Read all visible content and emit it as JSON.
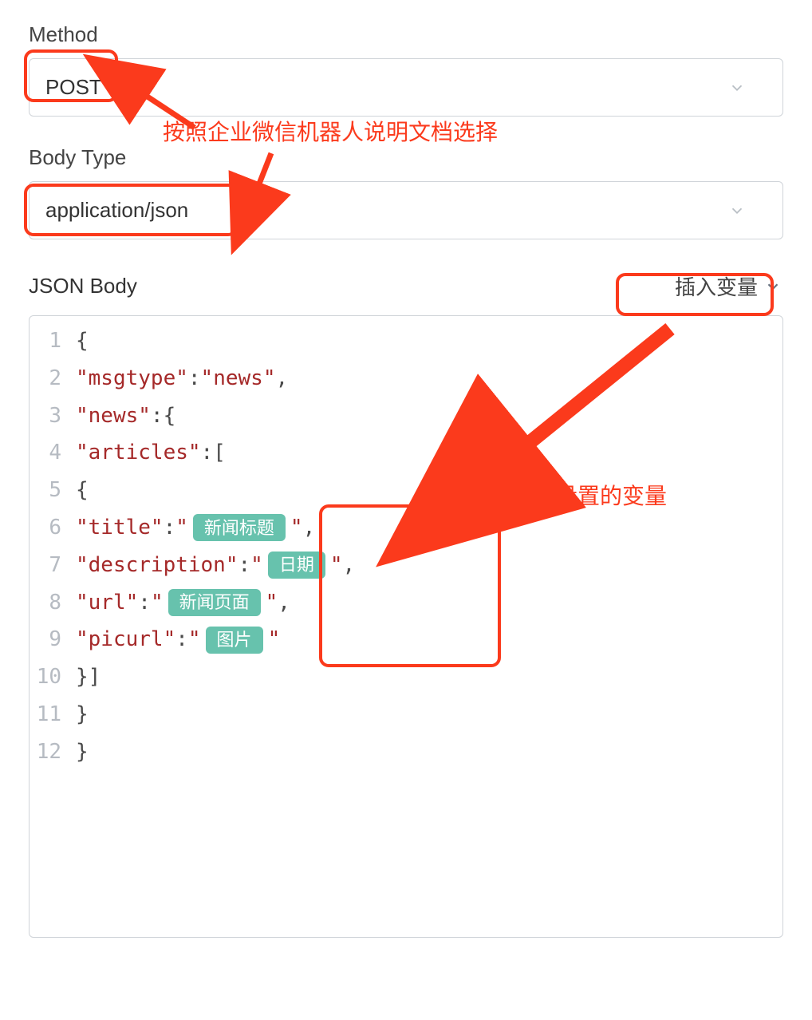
{
  "labels": {
    "method": "Method",
    "bodyType": "Body Type",
    "jsonBody": "JSON Body",
    "insertVar": "插入变量"
  },
  "method": {
    "value": "POST"
  },
  "bodyType": {
    "value": "application/json"
  },
  "annot": {
    "top": "按照企业微信机器人说明文档选择",
    "mid": "插入设置的变量"
  },
  "code": {
    "l1": "1",
    "t1a": "{",
    "l2": "2",
    "t2a": "\"msgtype\"",
    "t2b": ":",
    "t2c": "\"news\"",
    "t2d": ",",
    "l3": "3",
    "t3a": "\"news\"",
    "t3b": ":",
    "t3c": "{",
    "l4": "4",
    "t4a": "\"articles\"",
    "t4b": ":",
    "t4c": "[",
    "l5": "5",
    "t5a": "{",
    "l6": "6",
    "t6a": "\"title\"",
    "t6b": ":",
    "t6c": "\"",
    "t6d": "\"",
    "t6e": ",",
    "l7": "7",
    "t7a": "\"description\"",
    "t7b": ":",
    "t7c": "\"",
    "t7d": "\"",
    "t7e": ",",
    "l8": "8",
    "t8a": "\"url\"",
    "t8b": ":",
    "t8c": "\"",
    "t8d": "\"",
    "t8e": ",",
    "l9": "9",
    "t9a": "\"picurl\"",
    "t9b": ":",
    "t9c": "\"",
    "t9d": "\"",
    "l10": "10",
    "t10a": "}]",
    "l11": "11",
    "t11a": "}",
    "l12": "12",
    "t12a": "}"
  },
  "tags": {
    "title": "新闻标题",
    "desc": "日期",
    "url": "新闻页面",
    "pic": "图片"
  }
}
